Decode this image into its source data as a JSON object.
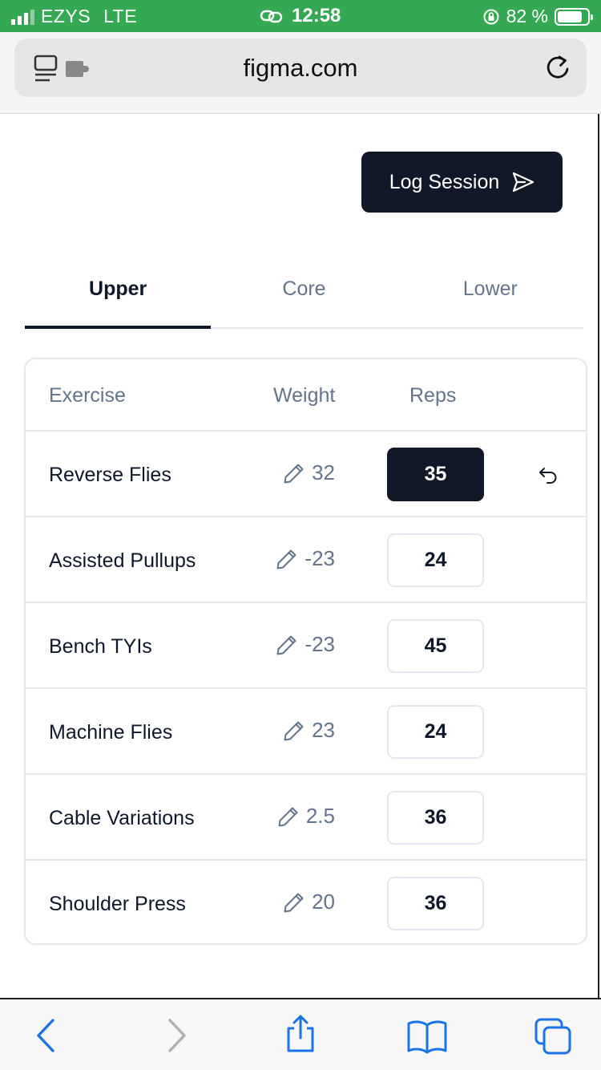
{
  "status_bar": {
    "carrier": "EZYS",
    "network": "LTE",
    "time": "12:58",
    "battery": "82 %",
    "battery_level": 0.82
  },
  "browser": {
    "url": "figma.com"
  },
  "page": {
    "log_session_label": "Log Session",
    "tabs": [
      {
        "label": "Upper",
        "active": true
      },
      {
        "label": "Core",
        "active": false
      },
      {
        "label": "Lower",
        "active": false
      }
    ],
    "table": {
      "headers": {
        "exercise": "Exercise",
        "weight": "Weight",
        "reps": "Reps"
      },
      "rows": [
        {
          "exercise": "Reverse Flies",
          "weight": "32",
          "reps": "35",
          "active": true
        },
        {
          "exercise": "Assisted Pullups",
          "weight": "-23",
          "reps": "24",
          "active": false
        },
        {
          "exercise": "Bench TYIs",
          "weight": "-23",
          "reps": "45",
          "active": false
        },
        {
          "exercise": "Machine Flies",
          "weight": "23",
          "reps": "24",
          "active": false
        },
        {
          "exercise": "Cable Variations",
          "weight": "2.5",
          "reps": "36",
          "active": false
        },
        {
          "exercise": "Shoulder Press",
          "weight": "20",
          "reps": "36",
          "active": false
        }
      ]
    }
  },
  "colors": {
    "status_bar_bg": "#34a853",
    "primary_dark": "#111827",
    "muted_text": "#64748b",
    "ios_blue": "#1a73e8"
  },
  "icons": {
    "url_bar_left": "tab-page-icon",
    "url_bar_right": "reload-icon",
    "log_button": "send-icon",
    "weight": "pencil-icon",
    "row_action": "undo-icon",
    "toolbar": [
      "back-icon",
      "forward-icon",
      "share-icon",
      "bookmarks-icon",
      "tabs-icon"
    ]
  }
}
